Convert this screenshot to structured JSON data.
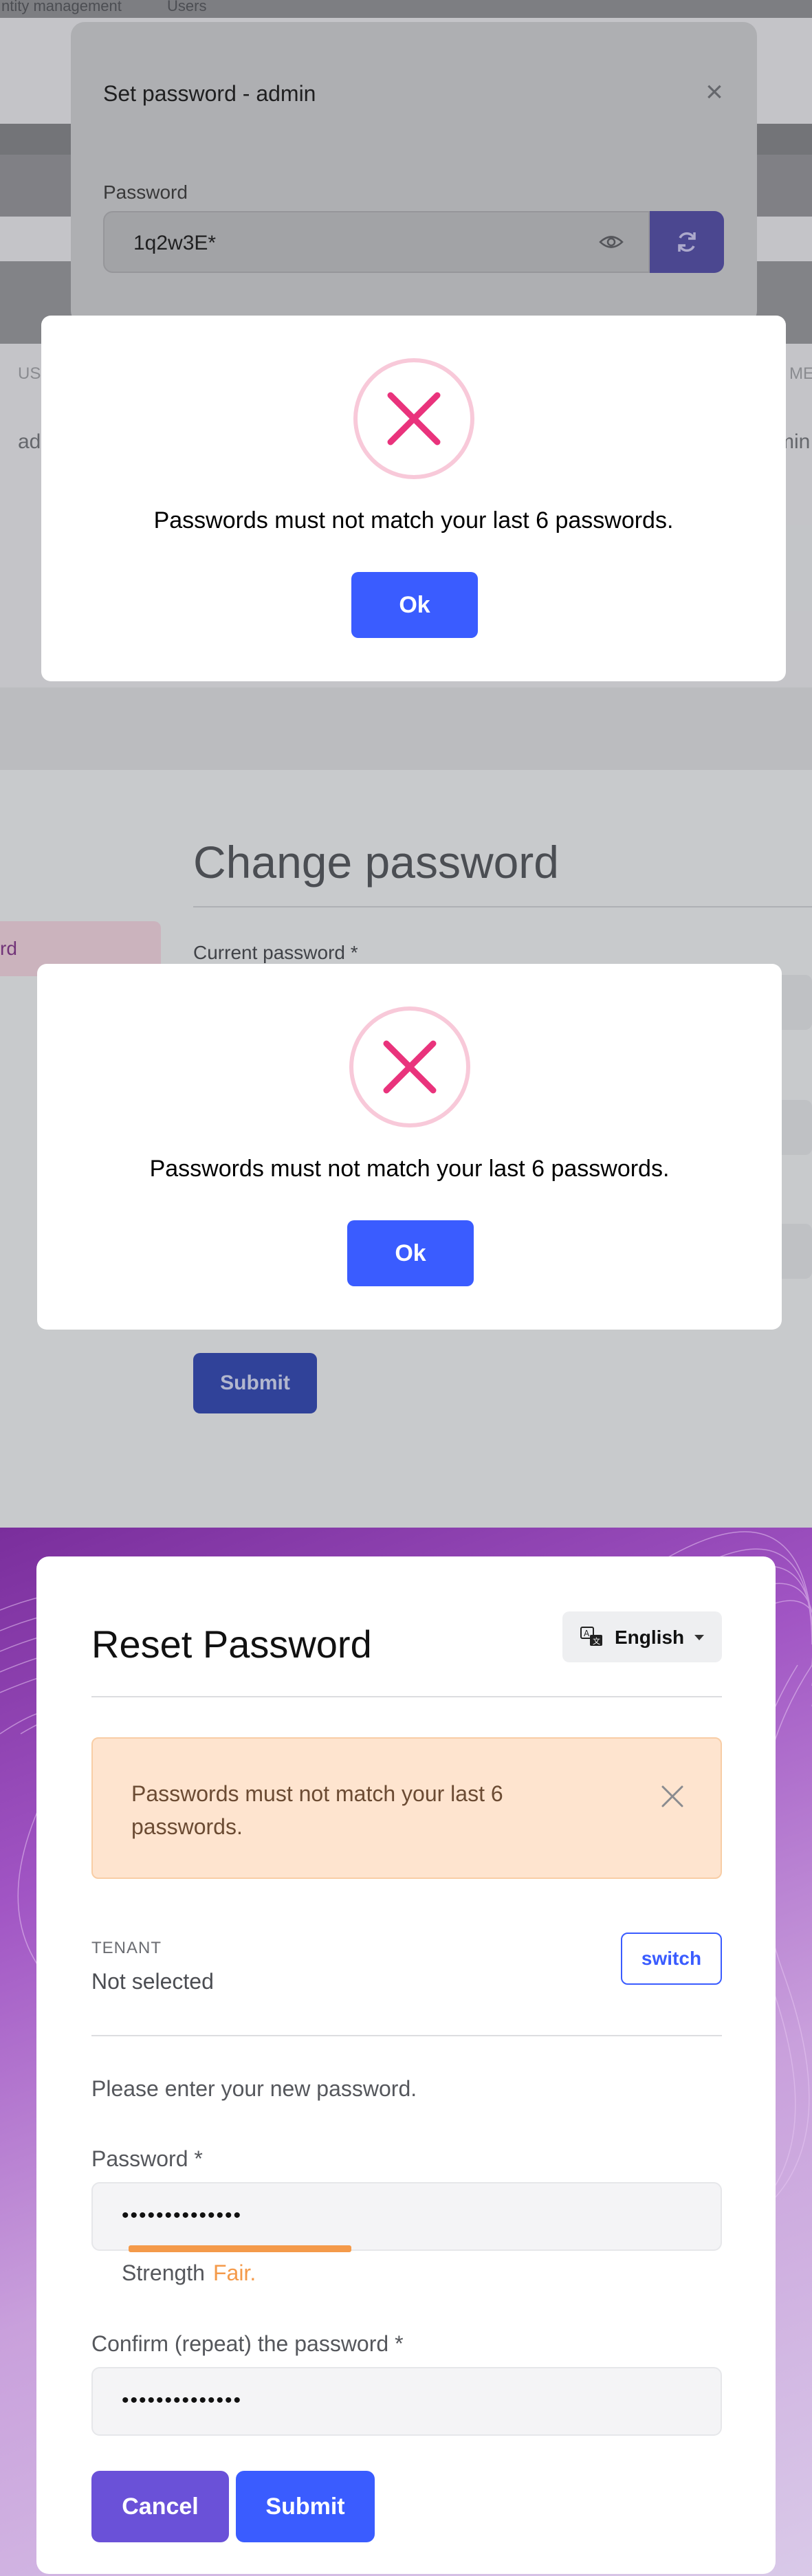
{
  "set_password_screen": {
    "top_nav": [
      "ntity management",
      "Users"
    ],
    "modal": {
      "title": "Set password - admin",
      "password_label": "Password",
      "password_value": "1q2w3E*"
    },
    "table": {
      "header_left": "US",
      "header_right": "ME",
      "cell_left": "ad",
      "cell_right": "min"
    },
    "alert": {
      "message": "Passwords must not match your last 6 passwords.",
      "ok_label": "Ok"
    }
  },
  "change_password_screen": {
    "title": "Change password",
    "sidebar_item": "rd",
    "current_password_label": "Current password *",
    "submit_label": "Submit",
    "alert": {
      "message": "Passwords must not match your last 6 passwords.",
      "ok_label": "Ok"
    }
  },
  "reset_password_screen": {
    "title": "Reset Password",
    "language": "English",
    "warning": "Passwords must not match your last 6 passwords.",
    "tenant_label": "TENANT",
    "tenant_value": "Not selected",
    "switch_label": "switch",
    "instruction": "Please enter your new password.",
    "password_label": "Password *",
    "password_dots": "••••••••••••••",
    "strength_label": "Strength",
    "strength_value": "Fair.",
    "strength_fraction": 0.35,
    "confirm_label": "Confirm (repeat) the password *",
    "confirm_dots": "••••••••••••••",
    "cancel_label": "Cancel",
    "submit_label": "Submit"
  },
  "colors": {
    "primary": "#3a5cff",
    "secondary": "#6a51d8",
    "error_icon": "#e9337c",
    "warning_bg": "#fee4cf",
    "strength_fair": "#f49a4a"
  },
  "icons": [
    "close-icon",
    "eye-icon",
    "refresh-icon",
    "error-x-icon",
    "translate-icon",
    "chevron-down-icon"
  ]
}
